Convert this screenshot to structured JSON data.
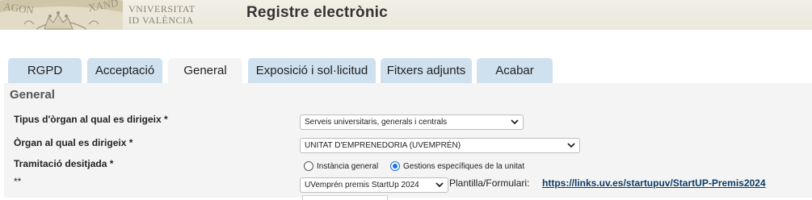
{
  "header": {
    "logo_line1": "VNIVERSITAT",
    "logo_line2": "ID VALÈNCIA",
    "seal_text": "AGONÆ • VNIVERSITAS • ALEXAND",
    "title": "Registre electrònic"
  },
  "tabs": [
    {
      "label": "RGPD",
      "active": false
    },
    {
      "label": "Acceptació",
      "active": false
    },
    {
      "label": "General",
      "active": true
    },
    {
      "label": "Exposició i sol·licitud",
      "active": false
    },
    {
      "label": "Fitxers adjunts",
      "active": false
    },
    {
      "label": "Acabar",
      "active": false
    }
  ],
  "form": {
    "section_title": "General",
    "tipus_label": "Tipus d'òrgan al qual es dirigeix *",
    "tipus_value": "Serveis universitaris, generals i centrals",
    "organ_label": "Òrgan al qual es dirigeix *",
    "organ_value": "UNITAT D'EMPRENEDORIA (UVEMPRÉN)",
    "tramitacio_label": "Tramitació desitjada *",
    "radio_options": [
      {
        "label": "Instància general",
        "checked": false
      },
      {
        "label": "Gestions específiques de la unitat",
        "checked": true
      }
    ],
    "procediment_label": "**",
    "procediment_value": "UVemprén premis StartUp 2024",
    "plantilla_label": "Plantilla/Formulari:",
    "plantilla_link": "https://links.uv.es/startupuv/StartUP-Premis2024"
  },
  "colors": {
    "tab_bg": "#cfe0ee",
    "panel_bg": "#f4f4f4",
    "link": "#0b3d66",
    "radio_checked": "#1a73e8"
  }
}
